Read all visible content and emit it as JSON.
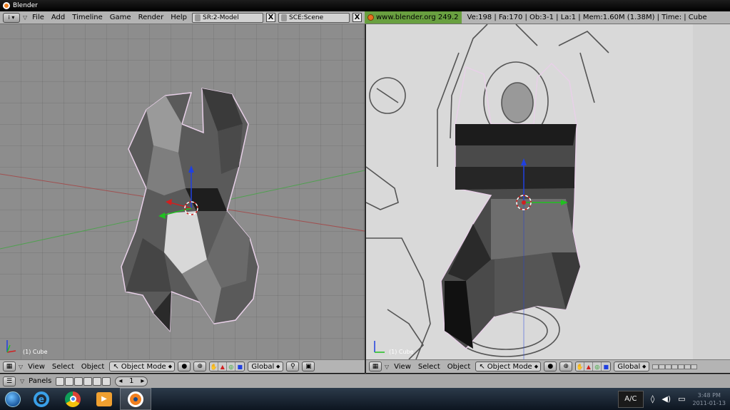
{
  "window": {
    "title": "Blender"
  },
  "info_header": {
    "menus": [
      "File",
      "Add",
      "Timeline",
      "Game",
      "Render",
      "Help"
    ],
    "screen_field": "SR:2-Model",
    "scene_field": "SCE:Scene",
    "link": "www.blender.org 249.2",
    "stats": "Ve:198 | Fa:170 | Ob:3-1 | La:1  | Mem:1.60M (1.38M)  | Time: | Cube"
  },
  "viewports": {
    "left": {
      "object_label": "(1) Cube"
    },
    "right": {
      "object_label": "(1) Cube"
    }
  },
  "view_header": {
    "menus": [
      "View",
      "Select",
      "Object"
    ],
    "mode": "Object Mode",
    "orientation": "Global"
  },
  "buttons_window": {
    "panels_label": "Panels",
    "frame": "1"
  },
  "taskbar": {
    "ac_label": "A/C",
    "time": "3:48 PM",
    "date": "2011-01-13"
  },
  "colors": {
    "header_bg": "#b4b4b4",
    "viewport_left_bg": "#8d8d8d",
    "link_bg": "#69a040",
    "axis_red": "#d02020",
    "axis_green": "#20c020",
    "axis_blue": "#2040e0"
  }
}
